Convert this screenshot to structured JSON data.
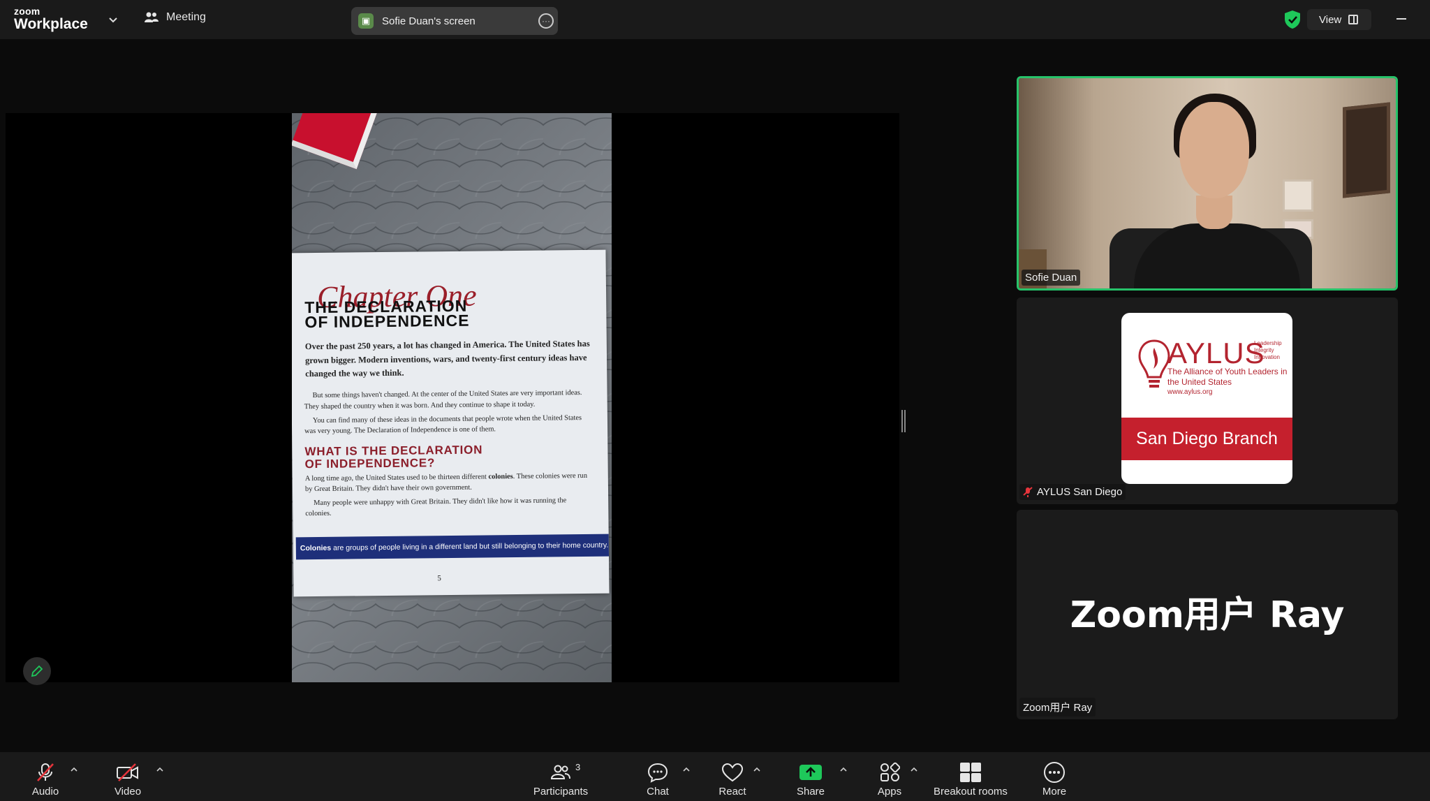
{
  "topbar": {
    "brand_small": "zoom",
    "brand_big": "Workplace",
    "meeting_label": "Meeting",
    "share_indicator": "Sofie Duan's screen",
    "view_label": "View"
  },
  "shared_doc": {
    "chapter": "Chapter One",
    "title_line1": "THE DECLARATION",
    "title_line2": "OF INDEPENDENCE",
    "intro": "Over the past 250 years, a lot has changed in America. The United States has grown bigger. Modern inventions, wars, and twenty-first century ideas have changed the way we think.",
    "para1": "But some things haven't changed. At the center of the United States are very important ideas. They shaped the country when it was born. And they continue to shape it today.",
    "para2": "You can find many of these ideas in the documents that people wrote when the United States was very young. The Declaration of Independence is one of them.",
    "heading_line1": "WHAT IS THE DECLARATION",
    "heading_line2": "OF INDEPENDENCE?",
    "para3_pre": "A long time ago, the United States used to be thirteen different ",
    "para3_bold": "colonies",
    "para3_post": ". These colonies were run by Great Britain. They didn't have their own government.",
    "para4": "Many people were unhappy with Great Britain. They didn't like how it was running the colonies.",
    "definition_term": "Colonies",
    "definition_text": " are groups of people living in a different land but still belonging to their home country.",
    "page_number": "5"
  },
  "participants_panel": {
    "video_name": "Sofie Duan",
    "aylus": {
      "word": "AYLUS",
      "tagline": [
        "Leadership",
        "Integrity",
        "Innovation"
      ],
      "full_name": "The Alliance of Youth Leaders in the United States",
      "url": "www.aylus.org",
      "branch": "San Diego Branch",
      "name": "AYLUS San Diego"
    },
    "ray": {
      "display": "Zoom用户 Ray",
      "name": "Zoom用户 Ray"
    }
  },
  "toolbar": {
    "audio": "Audio",
    "video": "Video",
    "participants": "Participants",
    "participants_count": "3",
    "chat": "Chat",
    "react": "React",
    "share": "Share",
    "apps": "Apps",
    "breakout": "Breakout rooms",
    "more": "More"
  },
  "colors": {
    "active_speaker": "#27c36a",
    "share_green": "#1ec85a",
    "muted_red": "#e5343b",
    "aylus_red": "#c5202d"
  }
}
